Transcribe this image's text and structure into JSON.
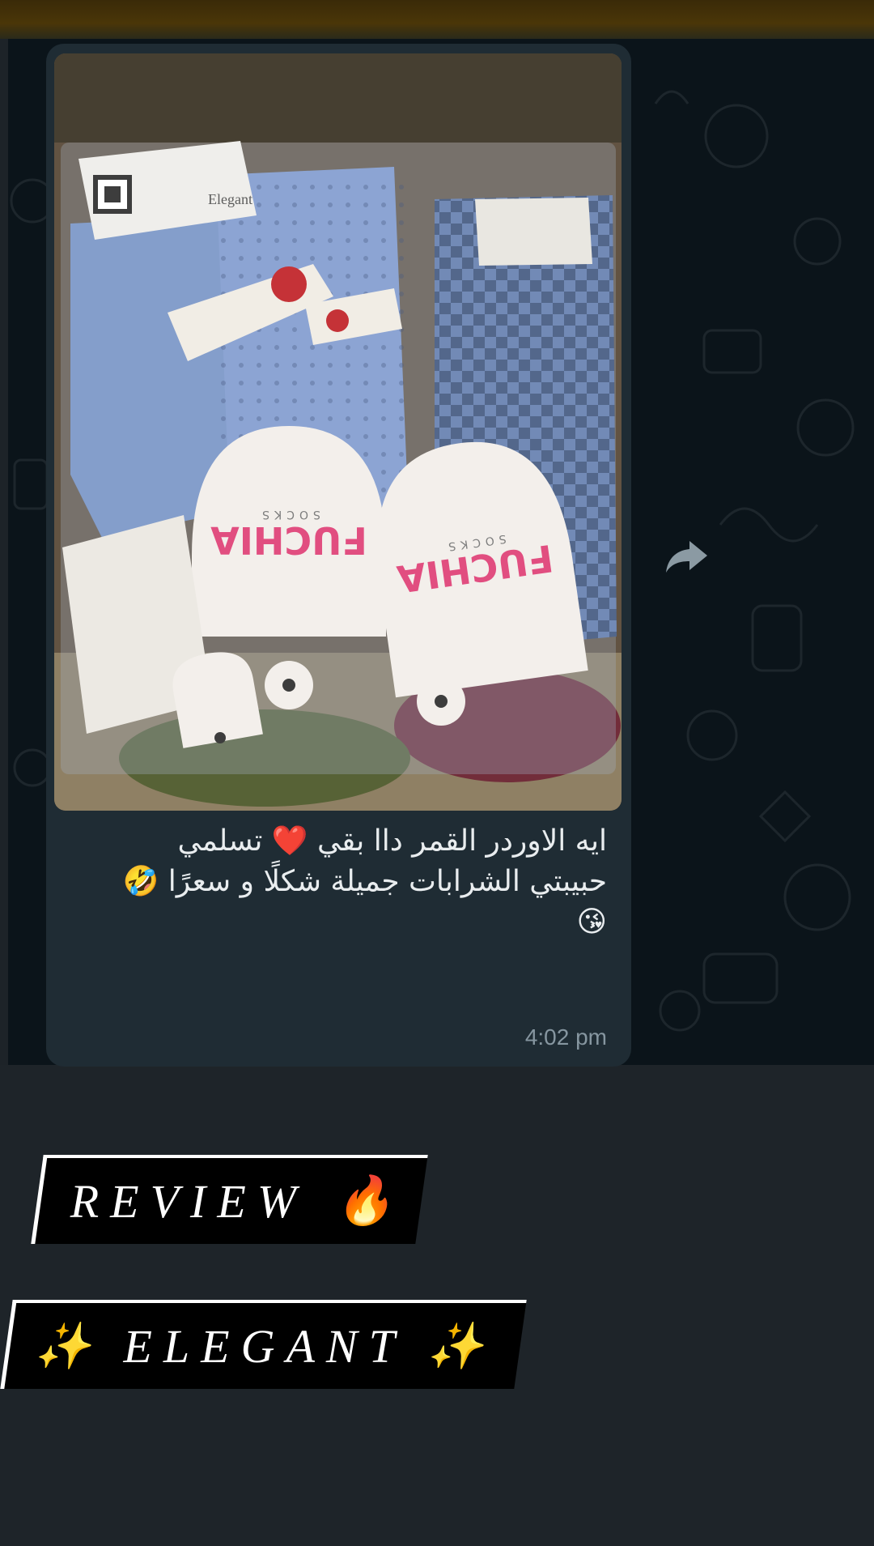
{
  "message": {
    "lines": [
      "ايه الاوردر القمر داا بقي ❤️ تسلمي",
      "حبيبتي الشرابات جميلة شكلًا و سعرًا 🤣",
      "😘"
    ],
    "time": "4:02 pm"
  },
  "photo": {
    "brand_text": "FUCHIA",
    "brand_sub": "SOCKS",
    "card_text": "Elegant"
  },
  "labels": {
    "review_text": "REVIEW",
    "review_emoji": "🔥",
    "elegant_text": "ELEGANT",
    "elegant_emoji": "✨"
  },
  "icons": {
    "forward": "forward-arrow-icon"
  },
  "colors": {
    "chat_background": "#0b141a",
    "bubble": "#1f2c34",
    "message_text": "#e9edef",
    "timestamp": "#8696a0",
    "label_background": "#000000"
  }
}
